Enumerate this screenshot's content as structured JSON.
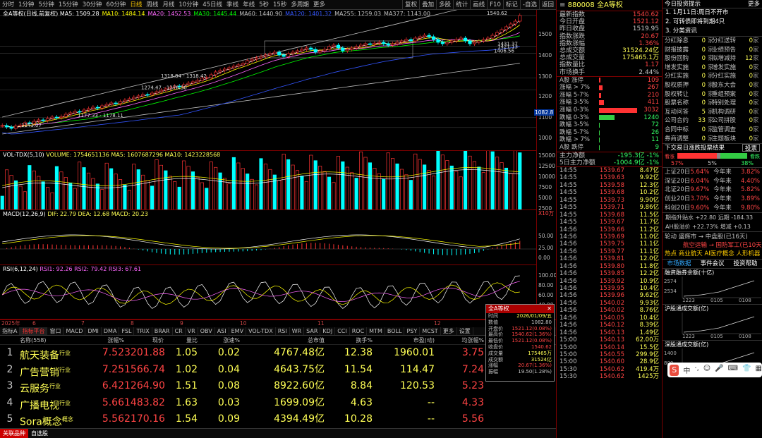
{
  "topbar": {
    "tabs": [
      "分时",
      "1分钟",
      "5分钟",
      "15分钟",
      "30分钟",
      "60分钟",
      "日线",
      "周线",
      "月线",
      "10分钟",
      "45日线",
      "季线",
      "年线",
      "5秒",
      "15秒",
      "多周期",
      "更多"
    ],
    "active": "日线",
    "right_buttons": [
      "复权",
      "叠加",
      "多股",
      "统计",
      "画线",
      "F10",
      "标记",
      "-自选",
      "返回"
    ]
  },
  "main_chart": {
    "title": "全A等权(日线,前复权)",
    "ma": [
      {
        "label": "MA5: 1509.28",
        "color": "#ffffff"
      },
      {
        "label": "MA10: 1484.14",
        "color": "#ffff00"
      },
      {
        "label": "MA20: 1452.53",
        "color": "#ff66ff"
      },
      {
        "label": "MA30: 1445.44",
        "color": "#00ff00"
      },
      {
        "label": "MA60: 1440.90",
        "color": "#c0c0c0"
      },
      {
        "label": "MA120: 1401.32",
        "color": "#3355ff"
      },
      {
        "label": "MA255: 1259.03",
        "color": "#c0c0c0"
      },
      {
        "label": "MA377: 1143.00",
        "color": "#c0c0c0"
      }
    ],
    "axis_labels": [
      "1500",
      "1400",
      "1300",
      "1200",
      "1100",
      "1000"
    ],
    "price_tag": "1082.8",
    "annotations": [
      "1540.62",
      "1431.37",
      "1421.13",
      "1406.56",
      "1318.84 - 1318.42",
      "1274.47 - 1276.30",
      "1177.33 - 1178.11",
      "1143.07"
    ],
    "candles": [
      1150,
      1145,
      1140,
      1148,
      1152,
      1160,
      1158,
      1165,
      1170,
      1168,
      1175,
      1180,
      1178,
      1182,
      1190,
      1195,
      1200,
      1198,
      1205,
      1210,
      1215,
      1212,
      1220,
      1225,
      1230,
      1228,
      1235,
      1240,
      1245,
      1250,
      1255,
      1260,
      1258,
      1265,
      1270,
      1275,
      1280,
      1285,
      1290,
      1288,
      1295,
      1300,
      1305,
      1310,
      1318,
      1320,
      1330,
      1340,
      1345,
      1350,
      1355,
      1360,
      1365,
      1370,
      1380,
      1385,
      1390,
      1395,
      1400,
      1405,
      1410,
      1400,
      1395,
      1405,
      1410,
      1415,
      1420,
      1425,
      1420,
      1410,
      1415,
      1420,
      1430,
      1435,
      1425,
      1415,
      1420,
      1425,
      1430,
      1435,
      1440,
      1438,
      1442,
      1445,
      1440,
      1435,
      1440,
      1445,
      1450,
      1455,
      1450,
      1460,
      1465,
      1470,
      1465,
      1455,
      1445,
      1440,
      1445,
      1450,
      1455,
      1460,
      1450,
      1440,
      1445,
      1450,
      1455,
      1460,
      1470,
      1480,
      1490,
      1500,
      1510,
      1520,
      1540
    ]
  },
  "volume": {
    "title": "VOL-TDX(5,10)",
    "values": "VOLUME: 1754651136  MA5: 1607687296  MA10: 1423228568",
    "axis_labels": [
      "15000",
      "12500",
      "10000",
      "7500",
      "5000",
      "2500"
    ],
    "unit": "X10万"
  },
  "macd": {
    "title": "MACD(12,26,9)",
    "values": "DIF: 22.79  DEA: 12.68  MACD: 20.23",
    "axis_labels": [
      "50.00",
      "25.00",
      "0.00"
    ]
  },
  "rsi": {
    "title": "RSI(6,12,24)",
    "values": "RSI1: 92.26  RSI2: 79.42  RSI3: 67.61",
    "axis_labels": [
      "100.00",
      "80.00",
      "60.00",
      "40.00",
      "20.00"
    ]
  },
  "dates": [
    "2025年",
    "6",
    "7",
    "8",
    "9",
    "10",
    "11",
    "12"
  ],
  "indicator_tabs": [
    "指标A",
    "指标平台",
    "窗口",
    "MACD",
    "DMI",
    "DMA",
    "FSL",
    "TRIX",
    "BRAR",
    "CR",
    "VR",
    "OBV",
    "ASI",
    "EMV",
    "VOL-TDX",
    "RSI",
    "WR",
    "SAR",
    "KDJ",
    "CCI",
    "ROC",
    "MTM",
    "BOLL",
    "PSY",
    "MCST",
    "更多",
    "设置"
  ],
  "indicator_active": "指标平台",
  "table": {
    "headers": [
      "",
      "名称(558)",
      "涨幅%",
      "现价",
      "量比",
      "涨速%",
      "总市值",
      "换手%",
      "市盈(动)",
      "均涨幅%"
    ],
    "rows": [
      {
        "no": "1",
        "name": "航天装备",
        "tag": "行业",
        "chg": "7.52",
        "price": "3201.88",
        "vr": "1.05",
        "spd": "0.02",
        "cap": "4767.48亿",
        "turn": "12.38",
        "pe": "1960.01",
        "avg": "3.75"
      },
      {
        "no": "2",
        "name": "广告营销",
        "tag": "行业",
        "chg": "7.25",
        "price": "1566.74",
        "vr": "1.02",
        "spd": "0.04",
        "cap": "4643.75亿",
        "turn": "11.54",
        "pe": "114.47",
        "avg": "7.24"
      },
      {
        "no": "3",
        "name": "云服务",
        "tag": "行业",
        "chg": "6.42",
        "price": "1264.90",
        "vr": "1.51",
        "spd": "0.08",
        "cap": "8922.60亿",
        "turn": "8.84",
        "pe": "120.53",
        "avg": "5.23"
      },
      {
        "no": "4",
        "name": "广播电视",
        "tag": "行业",
        "chg": "5.66",
        "price": "1483.82",
        "vr": "1.63",
        "spd": "0.03",
        "cap": "1699.09亿",
        "turn": "4.63",
        "pe": "--",
        "avg": "4.33"
      },
      {
        "no": "5",
        "name": "Sora概念",
        "tag": "概念",
        "chg": "5.56",
        "price": "2170.16",
        "vr": "1.54",
        "spd": "0.09",
        "cap": "4394.49亿",
        "turn": "10.28",
        "pe": "--",
        "avg": "5.56"
      }
    ]
  },
  "bottombar": [
    "关联品种",
    "自选股"
  ],
  "quote": {
    "code": "880008",
    "name": "全A等权",
    "rows": [
      {
        "l": "最新指数",
        "v": "1540.62",
        "c": "red"
      },
      {
        "l": "今日开盘",
        "v": "1521.12",
        "c": "red"
      },
      {
        "l": "昨日收盘",
        "v": "1519.95",
        "c": ""
      },
      {
        "l": "指数涨跌",
        "v": "20.67",
        "c": "red"
      },
      {
        "l": "指数涨幅",
        "v": "1.36%",
        "c": "red"
      },
      {
        "l": "总成交额",
        "v": "31524.24亿",
        "c": "yel"
      },
      {
        "l": "总成交量",
        "v": "175465.1万",
        "c": "yel"
      },
      {
        "l": "指数量比",
        "v": "1.17",
        "c": "red"
      },
      {
        "l": "市场换手",
        "v": "2.44%",
        "c": ""
      }
    ],
    "ad": [
      {
        "l": "A股 涨停",
        "v": "109",
        "c": "red",
        "w": 0.03
      },
      {
        "l": "涨幅 > 7%",
        "v": "267",
        "c": "red",
        "w": 0.08
      },
      {
        "l": "涨幅 5-7%",
        "v": "210",
        "c": "red",
        "w": 0.06
      },
      {
        "l": "涨幅 3-5%",
        "v": "411",
        "c": "red",
        "w": 0.13
      },
      {
        "l": "涨幅 0-3%",
        "v": "3032",
        "c": "red",
        "w": 0.95
      },
      {
        "l": "跌幅 0-3%",
        "v": "1240",
        "c": "green",
        "w": 0.38
      },
      {
        "l": "跌幅 3-5%",
        "v": "72",
        "c": "green",
        "w": 0.02
      },
      {
        "l": "跌幅 5-7%",
        "v": "26",
        "c": "green",
        "w": 0.01
      },
      {
        "l": "跌幅 > 7%",
        "v": "11",
        "c": "green",
        "w": 0.005
      },
      {
        "l": "A股 跌停",
        "v": "9",
        "c": "green",
        "w": 0.003
      }
    ],
    "flow": [
      {
        "l": "主力净额",
        "v": "-195.3亿",
        "p": "-1%"
      },
      {
        "l": "5日主力净额",
        "v": "-1004.9亿",
        "p": "-1%"
      }
    ],
    "ticks": [
      {
        "t": "14:55",
        "p": "1539.67",
        "q": "8.47亿"
      },
      {
        "t": "14:55",
        "p": "1539.63",
        "q": "9.92亿"
      },
      {
        "t": "14:55",
        "p": "1539.58",
        "q": "12.3亿"
      },
      {
        "t": "14:55",
        "p": "1539.68",
        "q": "10.2亿"
      },
      {
        "t": "14:55",
        "p": "1539.73",
        "q": "9.90亿"
      },
      {
        "t": "14:55",
        "p": "1539.71",
        "q": "9.86亿"
      },
      {
        "t": "14:55",
        "p": "1539.68",
        "q": "11.5亿"
      },
      {
        "t": "14:55",
        "p": "1539.67",
        "q": "11.7亿"
      },
      {
        "t": "14:56",
        "p": "1539.66",
        "q": "11.2亿"
      },
      {
        "t": "14:56",
        "p": "1539.69",
        "q": "11.0亿"
      },
      {
        "t": "14:56",
        "p": "1539.75",
        "q": "11.1亿"
      },
      {
        "t": "14:56",
        "p": "1539.77",
        "q": "11.1亿"
      },
      {
        "t": "14:56",
        "p": "1539.81",
        "q": "12.0亿"
      },
      {
        "t": "14:56",
        "p": "1539.80",
        "q": "11.8亿"
      },
      {
        "t": "14:56",
        "p": "1539.85",
        "q": "12.2亿"
      },
      {
        "t": "14:56",
        "p": "1539.92",
        "q": "10.9亿"
      },
      {
        "t": "14:56",
        "p": "1539.95",
        "q": "10.4亿"
      },
      {
        "t": "14:56",
        "p": "1539.96",
        "q": "9.62亿"
      },
      {
        "t": "14:56",
        "p": "1540.02",
        "q": "9.93亿"
      },
      {
        "t": "14:56",
        "p": "1540.02",
        "q": "8.76亿"
      },
      {
        "t": "14:56",
        "p": "1540.05",
        "q": "10.4亿"
      },
      {
        "t": "14:56",
        "p": "1540.12",
        "q": "8.39亿"
      },
      {
        "t": "14:56",
        "p": "1540.13",
        "q": "1.49亿"
      },
      {
        "t": "15:00",
        "p": "1540.13",
        "q": "62.00万"
      },
      {
        "t": "15:00",
        "p": "1540.14",
        "q": "15.5亿"
      },
      {
        "t": "15:00",
        "p": "1540.55",
        "q": "299.9亿"
      },
      {
        "t": "15:00",
        "p": "1540.60",
        "q": "28.9亿"
      },
      {
        "t": "15:30",
        "p": "1540.62",
        "q": "419.4万"
      },
      {
        "t": "15:30",
        "p": "1540.62",
        "q": "1425万"
      }
    ]
  },
  "popup": {
    "title": "全A等权",
    "rows": [
      {
        "l": "时间",
        "v": "2026/01/09/五",
        "c": "yel"
      },
      {
        "l": "数值",
        "v": "1082.80",
        "c": ""
      },
      {
        "l": "开盘价",
        "v": "1521.12(0.08%)",
        "c": "red"
      },
      {
        "l": "最高价",
        "v": "1540.62(1.36%)",
        "c": "red"
      },
      {
        "l": "最低价",
        "v": "1521.12(0.08%)",
        "c": "red"
      },
      {
        "l": "收盘价",
        "v": "1540.62",
        "c": "red"
      },
      {
        "l": "成交量",
        "v": "175465万",
        "c": "yel"
      },
      {
        "l": "成交额",
        "v": "31524亿",
        "c": "yel"
      },
      {
        "l": "涨幅",
        "v": "20.67(1.36%)",
        "c": "red"
      },
      {
        "l": "振幅",
        "v": "19.50(1.28%)",
        "c": ""
      }
    ]
  },
  "news": {
    "title": "今日投资提示",
    "more": "更多",
    "items": [
      "1. 1月11日:周日不开市",
      "2. 可转债即将到期4只",
      "3. 分类资讯"
    ],
    "stats": [
      [
        "分红除息",
        "0",
        "分红送转",
        "0"
      ],
      [
        "财报披露",
        "0",
        "业绩预告",
        "0"
      ],
      [
        "股份回购",
        "0",
        "拟增减持",
        "12"
      ],
      [
        "增发实施",
        "0",
        "增发实施",
        "0"
      ],
      [
        "分红实施",
        "0",
        "分红实施",
        "0"
      ],
      [
        "股权质押",
        "0",
        "股东大会",
        "0"
      ],
      [
        "股权转让",
        "0",
        "重组预案",
        "0"
      ],
      [
        "股票名称",
        "0",
        "特别处理",
        "0"
      ],
      [
        "互动问答",
        "5",
        "机构调研",
        "0"
      ],
      [
        "公司合约",
        "33",
        "公司拼股",
        "0"
      ],
      [
        "合同中标",
        "0",
        "监管调查",
        "0"
      ],
      [
        "券商调整",
        "0",
        "主题板块",
        "0"
      ]
    ],
    "vote_title": "下交易日涨跌投票结果",
    "vote_btn": "投票",
    "vote": {
      "up_label": "看涨",
      "down_label": "看跌",
      "up": "57%",
      "flat": "5%",
      "down": "38%"
    },
    "indices": [
      [
        "上证20日",
        "5.64%",
        "今年来",
        "3.82%"
      ],
      [
        "深证20日",
        "6.04%",
        "今年来",
        "4.40%"
      ],
      [
        "北证20日",
        "9.67%",
        "今年来",
        "5.82%"
      ],
      [
        "创业20日",
        "3.70%",
        "今年来",
        "3.89%"
      ],
      [
        "科创20日",
        "9.60%",
        "今年来",
        "9.80%"
      ]
    ],
    "flows": [
      "期指升贴水 +22.80 远期 -184.33",
      "AH股溢价 +22.73% 增减 +0.13"
    ],
    "rotate": "轮动 盛辉市 → 中盘股(已16天)",
    "rotate2": "航空运输 → 国防军工(已10天)",
    "hot": "热点 商业航天 AI医疗概念 人形机器",
    "tabs2": [
      "市场数据",
      "事件会议",
      "投资帮助"
    ],
    "mini1": {
      "title": "融资融券余额(十亿)",
      "yl": [
        "2574",
        "2534"
      ],
      "xl": [
        "1223",
        "0105",
        "0108"
      ]
    },
    "mini2": {
      "title": "沪股通成交额(亿)",
      "xl": [
        "1223",
        "0105",
        "0108"
      ]
    },
    "mini3": {
      "title": "深股通成交额(亿)",
      "yl": [
        "1400",
        "800"
      ],
      "xl": [
        "1223",
        "0105",
        "0108"
      ]
    }
  },
  "ime": {
    "logo": "S",
    "items": [
      "中",
      "·,",
      "☺",
      "🎤",
      "⌨",
      "👕",
      "▦"
    ]
  }
}
